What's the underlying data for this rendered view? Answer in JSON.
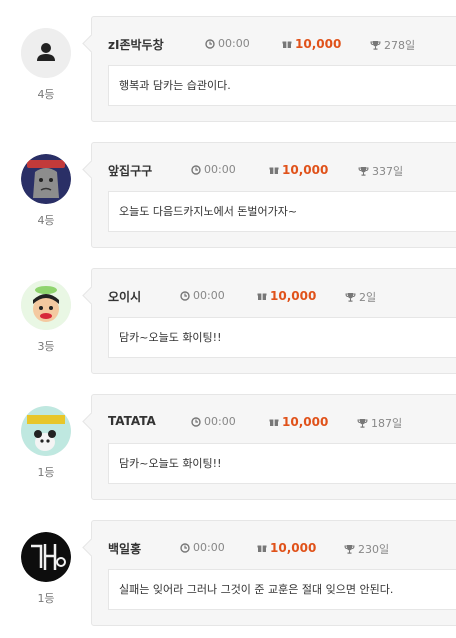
{
  "comments": [
    {
      "name": "zI존박두창",
      "time": "00:00",
      "points": "10,000",
      "days": "278일",
      "rank": "4등",
      "message": "행복과 담카는 습관이다.",
      "avatar_icon": "person-icon"
    },
    {
      "name": "앞집구구",
      "time": "00:00",
      "points": "10,000",
      "days": "337일",
      "rank": "4등",
      "message": "오늘도 다음드카지노에서 돈벌어가자~",
      "avatar_icon": "cartoon-avatar"
    },
    {
      "name": "오이시",
      "time": "00:00",
      "points": "10,000",
      "days": "2일",
      "rank": "3등",
      "message": "담카~오늘도 화이팅!!",
      "avatar_icon": "cartoon-avatar"
    },
    {
      "name": "TATATA",
      "time": "00:00",
      "points": "10,000",
      "days": "187일",
      "rank": "1등",
      "message": "담카~오늘도 화이팅!!",
      "avatar_icon": "cartoon-avatar"
    },
    {
      "name": "백일홍",
      "time": "00:00",
      "points": "10,000",
      "days": "230일",
      "rank": "1등",
      "message": "실패는 잊어라 그러나 그것이 준 교훈은 절대 잊으면 안된다.",
      "avatar_icon": "neon-sign-avatar"
    }
  ],
  "colors": {
    "points": "#e0521a",
    "card_bg": "#f6f6f6",
    "border": "#e6e6e6"
  }
}
